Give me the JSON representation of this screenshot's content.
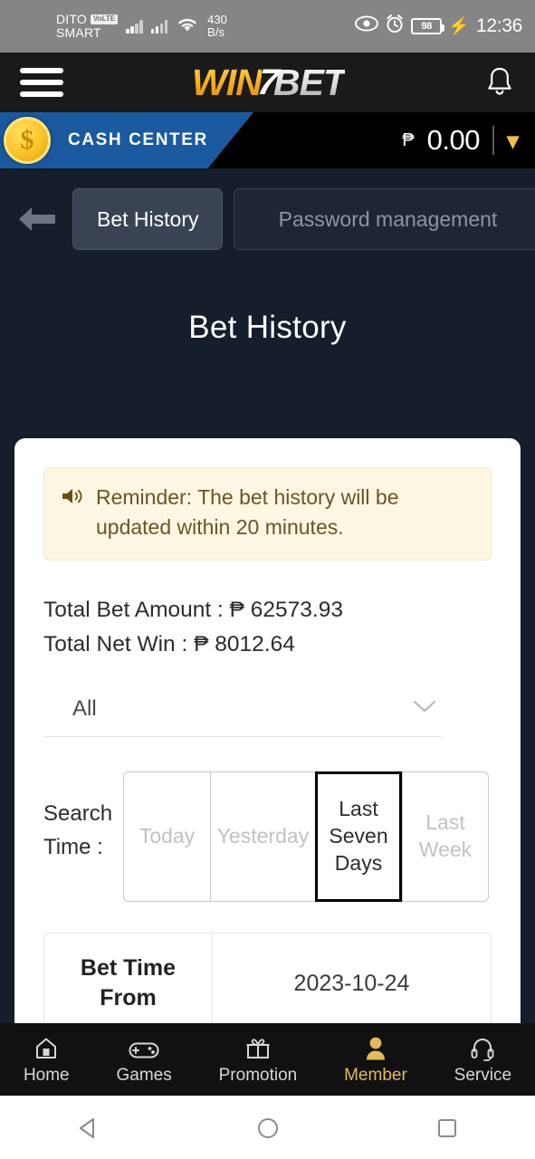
{
  "status_bar": {
    "carrier_primary": "DITO",
    "carrier_primary_badge": "VoLTE",
    "carrier_secondary": "SMART",
    "network_speed_value": "430",
    "network_speed_unit": "B/s",
    "battery_percent": "98",
    "time": "12:36"
  },
  "header": {
    "logo_win": "WIN",
    "logo_bolt": "7",
    "logo_bet": "BET",
    "menu_icon": "hamburger-icon",
    "notification_icon": "bell-icon"
  },
  "cash_bar": {
    "label": "CASH CENTER",
    "currency_symbol": "₱",
    "balance": "0.00",
    "coin_symbol": "$",
    "expand_icon": "chevron-down-icon"
  },
  "tabs": {
    "back_icon": "back-arrow-icon",
    "items": [
      {
        "label": "Bet History",
        "active": true
      },
      {
        "label": "Password management",
        "active": false
      }
    ]
  },
  "page": {
    "title": "Bet History"
  },
  "reminder": {
    "icon": "speaker-announcement-icon",
    "text": "Reminder:  The bet history will be updated within 20 minutes."
  },
  "totals": {
    "bet_amount_label": "Total Bet Amount :",
    "bet_amount_value": "₱ 62573.93",
    "net_win_label": "Total Net Win :",
    "net_win_value": "₱ 8012.64"
  },
  "category_select": {
    "value": "All",
    "caret_icon": "chevron-down-icon"
  },
  "search_time": {
    "label": "Search Time :",
    "options": [
      {
        "label": "Today",
        "selected": false
      },
      {
        "label": "Yesterday",
        "selected": false
      },
      {
        "label": "Last Seven Days",
        "selected": true
      },
      {
        "label": "Last Week",
        "selected": false
      }
    ]
  },
  "bet_table": {
    "rows": [
      {
        "label": "Bet Time From",
        "value": "2023-10-24"
      },
      {
        "label": "",
        "value": ""
      }
    ]
  },
  "bottom_nav": {
    "items": [
      {
        "label": "Home",
        "icon": "home-icon",
        "active": false
      },
      {
        "label": "Games",
        "icon": "gamepad-icon",
        "active": false
      },
      {
        "label": "Promotion",
        "icon": "gift-icon",
        "active": false
      },
      {
        "label": "Member",
        "icon": "user-icon",
        "active": true
      },
      {
        "label": "Service",
        "icon": "headset-icon",
        "active": false
      }
    ]
  },
  "android_nav": {
    "back_icon": "triangle-back-icon",
    "home_icon": "circle-home-icon",
    "recents_icon": "square-recents-icon"
  },
  "colors": {
    "brand_gold": "#f5a81c",
    "cash_blue": "#1b5a9e",
    "dark_bg": "#161d2b",
    "active_nav": "#e3ba5a"
  }
}
